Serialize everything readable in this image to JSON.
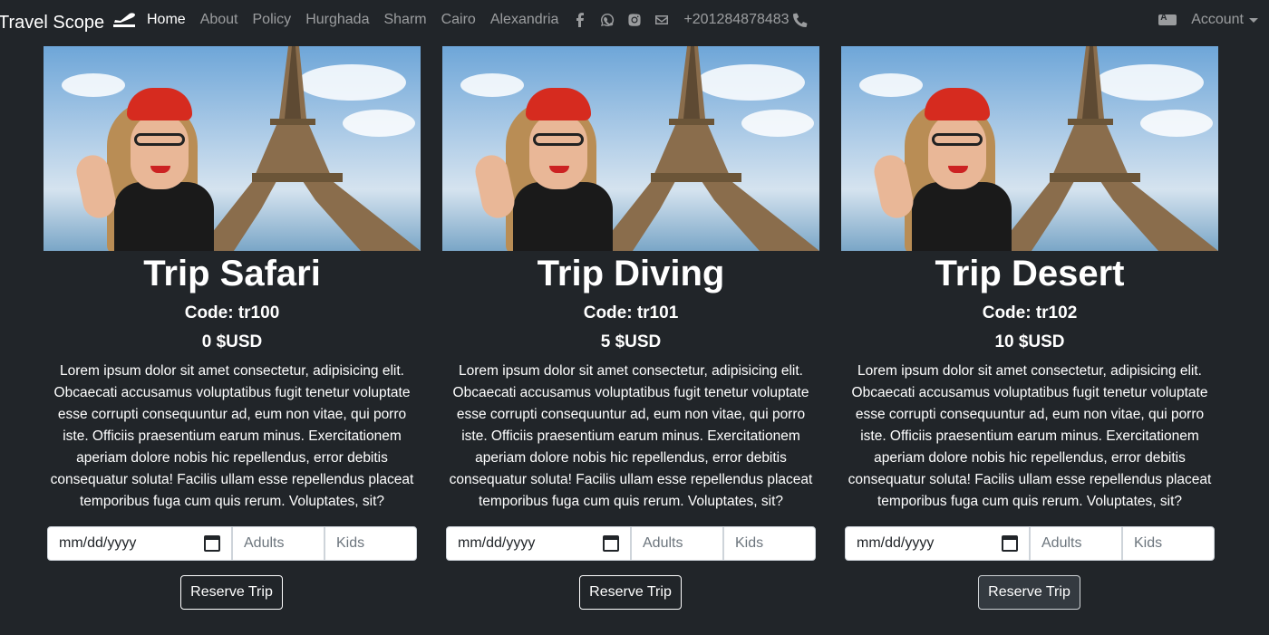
{
  "navbar": {
    "brand": "Travel Scope",
    "brand_icon": "plane-departure-icon",
    "links": [
      {
        "label": "Home",
        "active": true
      },
      {
        "label": "About"
      },
      {
        "label": "Policy"
      },
      {
        "label": "Hurghada"
      },
      {
        "label": "Sharm"
      },
      {
        "label": "Cairo"
      },
      {
        "label": "Alexandria"
      }
    ],
    "social_icons": [
      "facebook-icon",
      "whatsapp-icon",
      "instagram-icon",
      "envelope-icon"
    ],
    "phone": "+201284878483",
    "phone_icon": "phone-icon",
    "language_icon": "language-icon",
    "account_label": "Account"
  },
  "trips": [
    {
      "title": "Trip Safari",
      "code": "Code: tr100",
      "price": "0 $USD",
      "description": "Lorem ipsum dolor sit amet consectetur, adipisicing elit. Obcaecati accusamus voluptatibus fugit tenetur voluptate esse corrupti consequuntur ad, eum non vitae, qui porro iste. Officiis praesentium earum minus. Exercitationem aperiam dolore nobis hic repellendus, error debitis consequatur soluta! Facilis ullam esse repellendus placeat temporibus fuga cum quis rerum. Voluptates, sit?",
      "date_placeholder": "mm/dd/yyyy",
      "adults_placeholder": "Adults",
      "kids_placeholder": "Kids",
      "button": "Reserve Trip"
    },
    {
      "title": "Trip Diving",
      "code": "Code: tr101",
      "price": "5 $USD",
      "description": "Lorem ipsum dolor sit amet consectetur, adipisicing elit. Obcaecati accusamus voluptatibus fugit tenetur voluptate esse corrupti consequuntur ad, eum non vitae, qui porro iste. Officiis praesentium earum minus. Exercitationem aperiam dolore nobis hic repellendus, error debitis consequatur soluta! Facilis ullam esse repellendus placeat temporibus fuga cum quis rerum. Voluptates, sit?",
      "date_placeholder": "mm/dd/yyyy",
      "adults_placeholder": "Adults",
      "kids_placeholder": "Kids",
      "button": "Reserve Trip"
    },
    {
      "title": "Trip Desert",
      "code": "Code: tr102",
      "price": "10 $USD",
      "description": "Lorem ipsum dolor sit amet consectetur, adipisicing elit. Obcaecati accusamus voluptatibus fugit tenetur voluptate esse corrupti consequuntur ad, eum non vitae, qui porro iste. Officiis praesentium earum minus. Exercitationem aperiam dolore nobis hic repellendus, error debitis consequatur soluta! Facilis ullam esse repellendus placeat temporibus fuga cum quis rerum. Voluptates, sit?",
      "date_placeholder": "mm/dd/yyyy",
      "adults_placeholder": "Adults",
      "kids_placeholder": "Kids",
      "button": "Reserve Trip"
    }
  ],
  "colors": {
    "background": "#212529",
    "nav_muted": "#8c8f92",
    "beret": "#d62b1f"
  }
}
